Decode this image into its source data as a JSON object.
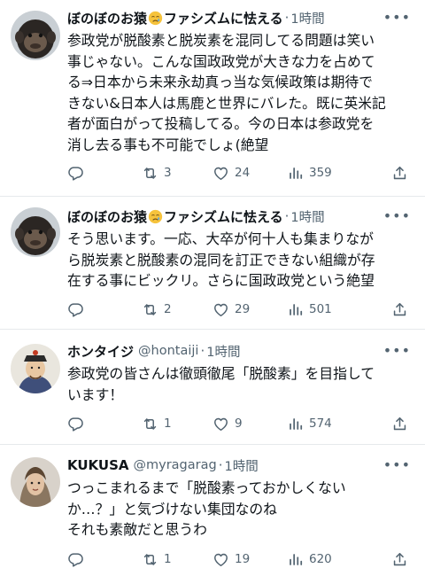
{
  "tweets": [
    {
      "name": "ぼのぼのお猿",
      "name_suffix": "ファシズムに怯える",
      "emoji": "crying-face-emoji",
      "handle": "",
      "time": "1時間",
      "lines": [
        "参政党が脱酸素と脱炭素を混同してる問題は笑い",
        "事じゃない。こんな国政政党が大きな力を占めて",
        "る⇒日本から未来永劫真っ当な気候政策は期待で",
        "きない&日本人は馬鹿と世界にバレた。既に英米記",
        "者が面白がって投稿してる。今の日本は参政党を",
        "消し去る事も不可能でしょ(絶望"
      ],
      "reply_count": "",
      "retweet_count": "3",
      "like_count": "24",
      "view_count": "359"
    },
    {
      "name": "ぼのぼのお猿",
      "name_suffix": "ファシズムに怯える",
      "emoji": "crying-face-emoji",
      "handle": "",
      "time": "1時間",
      "lines": [
        "そう思います。一応、大卒が何十人も集まりなが",
        "ら脱炭素と脱酸素の混同を訂正できない組織が存",
        "在する事にビックリ。さらに国政政党という絶望"
      ],
      "reply_count": "",
      "retweet_count": "2",
      "like_count": "29",
      "view_count": "501"
    },
    {
      "name": "ホンタイジ",
      "name_suffix": "",
      "emoji": "",
      "handle": "@hontaiji",
      "time": "1時間",
      "lines": [
        "参政党の皆さんは徹頭徹尾「脱酸素」を目指して",
        "います！"
      ],
      "reply_count": "",
      "retweet_count": "1",
      "like_count": "9",
      "view_count": "574"
    },
    {
      "name": "KUKUSA",
      "name_suffix": "",
      "emoji": "",
      "handle": "@myragarag",
      "time": "1時間",
      "lines": [
        "つっこまれるまで「脱酸素っておかしくない",
        "か…？」と気づけない集団なのね",
        "それも素敵だと思うわ"
      ],
      "reply_count": "",
      "retweet_count": "1",
      "like_count": "19",
      "view_count": "620"
    }
  ],
  "icons": {
    "more": "more-options-icon",
    "reply": "reply-icon",
    "retweet": "retweet-icon",
    "like": "heart-icon",
    "views": "views-bar-chart-icon",
    "share": "share-icon"
  },
  "colors": {
    "text": "#0f1419",
    "secondary": "#536471",
    "divider": "#e6e9ec"
  }
}
